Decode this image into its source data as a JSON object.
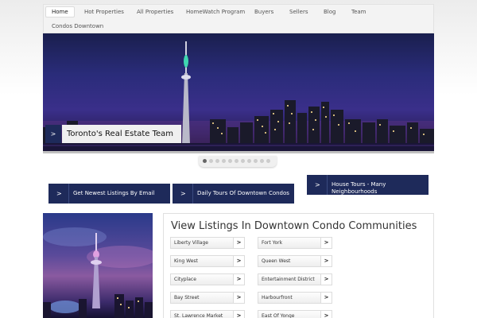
{
  "nav": {
    "items": [
      {
        "label": "Home"
      },
      {
        "label": "Hot Properties"
      },
      {
        "label": "All Properties"
      },
      {
        "label": "HomeWatch Program"
      },
      {
        "label": "Buyers"
      },
      {
        "label": "Sellers"
      },
      {
        "label": "Blog"
      },
      {
        "label": "Team"
      },
      {
        "label": "Condos Downtown"
      }
    ]
  },
  "hero": {
    "arrow": ">",
    "caption": "Toronto's Real Estate Team",
    "slide_count": 11,
    "active_slide": 1
  },
  "cta": [
    {
      "arrow": ">",
      "label": "Get Newest Listings By Email"
    },
    {
      "arrow": ">",
      "label": "Daily Tours Of Downtown Condos"
    },
    {
      "arrow": ">",
      "label": "House Tours - Many Neighbourhoods"
    }
  ],
  "listings": {
    "title": "View Listings In Downtown Condo Communities",
    "arrow": ">",
    "left": [
      "Liberty Village",
      "King West",
      "Cityplace",
      "Bay Street",
      "St. Lawrence Market"
    ],
    "right": [
      "Fort York",
      "Queen West",
      "Entertainment District",
      "Harbourfront",
      "East Of Yonge"
    ]
  },
  "colors": {
    "accent": "#1e2a5a",
    "nav_bg": "#f3f3f3"
  }
}
